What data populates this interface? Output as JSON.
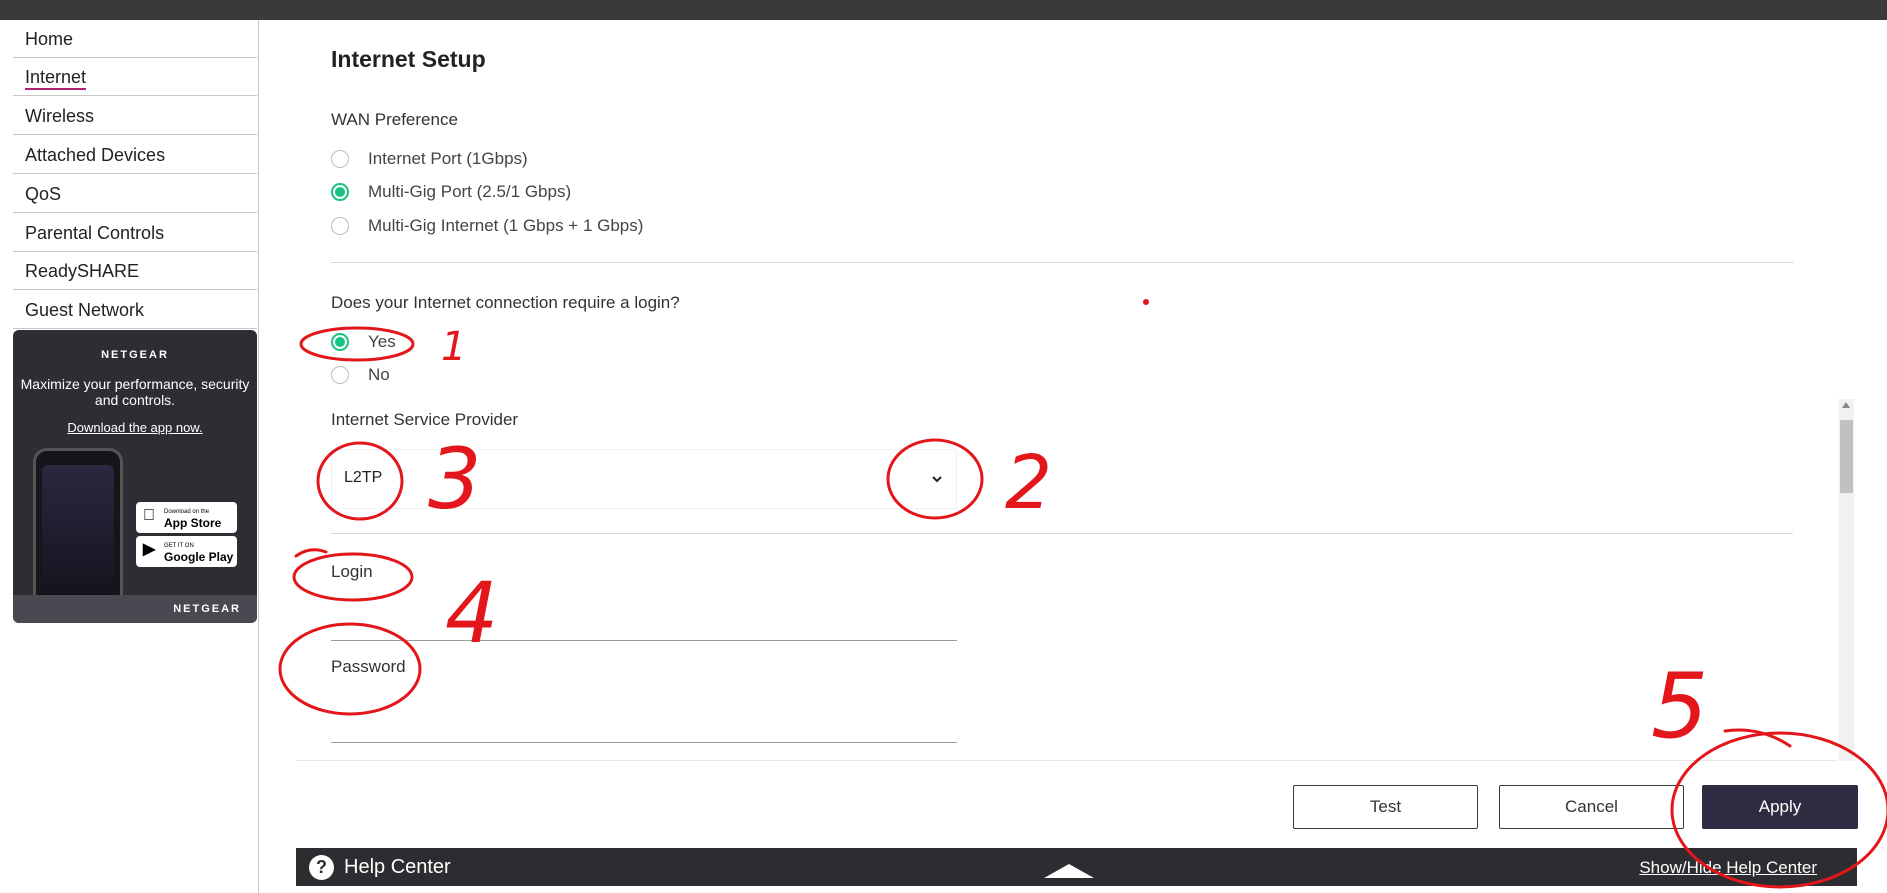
{
  "sidebar": {
    "items": [
      {
        "label": "Home"
      },
      {
        "label": "Internet"
      },
      {
        "label": "Wireless"
      },
      {
        "label": "Attached Devices"
      },
      {
        "label": "QoS"
      },
      {
        "label": "Parental Controls"
      },
      {
        "label": "ReadySHARE"
      },
      {
        "label": "Guest Network"
      }
    ],
    "active": "Internet",
    "promo": {
      "brand": "NETGEAR",
      "text": "Maximize your performance, security and controls.",
      "link": "Download the app now.",
      "app_store_small": "Download on the",
      "app_store": "App Store",
      "google_play_small": "GET IT ON",
      "google_play": "Google Play",
      "footer_brand": "NETGEAR"
    }
  },
  "main": {
    "title": "Internet Setup",
    "wan": {
      "label": "WAN Preference",
      "options": [
        {
          "label": "Internet Port (1Gbps)",
          "checked": false
        },
        {
          "label": "Multi-Gig Port (2.5/1 Gbps)",
          "checked": true
        },
        {
          "label": "Multi-Gig Internet (1 Gbps + 1 Gbps)",
          "checked": false
        }
      ]
    },
    "login_required": {
      "label": "Does your Internet connection require a login?",
      "options": [
        {
          "label": "Yes",
          "checked": true
        },
        {
          "label": "No",
          "checked": false
        }
      ]
    },
    "isp": {
      "label": "Internet Service Provider",
      "value": "L2TP"
    },
    "login": {
      "label": "Login",
      "value": ""
    },
    "password": {
      "label": "Password",
      "value": ""
    }
  },
  "buttons": {
    "test": "Test",
    "cancel": "Cancel",
    "apply": "Apply"
  },
  "help": {
    "icon": "?",
    "label": "Help Center",
    "toggle": "Show/Hide Help Center"
  },
  "annotations": {
    "color": "#e3161b",
    "numbers": [
      "1",
      "2",
      "3",
      "4",
      "5"
    ]
  },
  "colors": {
    "accent_green": "#15c47e",
    "primary_button": "#2f2b40",
    "active_underline": "#b0236e",
    "topbar": "#3a3a3a"
  }
}
